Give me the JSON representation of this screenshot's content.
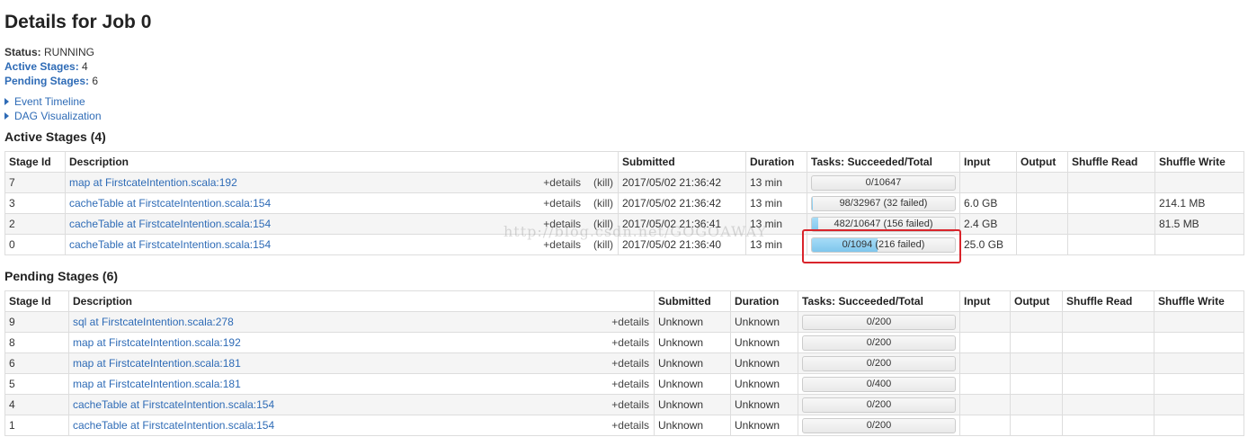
{
  "page": {
    "title": "Details for Job 0",
    "status_label": "Status:",
    "status_value": "RUNNING",
    "active_label": "Active Stages:",
    "active_value": "4",
    "pending_label": "Pending Stages:",
    "pending_value": "6",
    "event_timeline": "Event Timeline",
    "dag_visualization": "DAG Visualization"
  },
  "active": {
    "title": "Active Stages (4)",
    "headers": [
      "Stage Id",
      "Description",
      "Submitted",
      "Duration",
      "Tasks: Succeeded/Total",
      "Input",
      "Output",
      "Shuffle Read",
      "Shuffle Write"
    ],
    "rows": [
      {
        "id": "7",
        "desc": "map at FirstcateIntention.scala:192",
        "details": "+details",
        "kill": "(kill)",
        "submitted": "2017/05/02 21:36:42",
        "duration": "13 min",
        "tasks": "0/10647",
        "progress": 0.0,
        "input": "",
        "output": "",
        "shuffle_read": "",
        "shuffle_write": ""
      },
      {
        "id": "3",
        "desc": "cacheTable at FirstcateIntention.scala:154",
        "details": "+details",
        "kill": "(kill)",
        "submitted": "2017/05/02 21:36:42",
        "duration": "13 min",
        "tasks": "98/32967 (32 failed)",
        "progress": 0.003,
        "input": "6.0 GB",
        "output": "",
        "shuffle_read": "",
        "shuffle_write": "214.1 MB"
      },
      {
        "id": "2",
        "desc": "cacheTable at FirstcateIntention.scala:154",
        "details": "+details",
        "kill": "(kill)",
        "submitted": "2017/05/02 21:36:41",
        "duration": "13 min",
        "tasks": "482/10647 (156 failed)",
        "progress": 0.045,
        "input": "2.4 GB",
        "output": "",
        "shuffle_read": "",
        "shuffle_write": "81.5 MB"
      },
      {
        "id": "0",
        "desc": "cacheTable at FirstcateIntention.scala:154",
        "details": "+details",
        "kill": "(kill)",
        "submitted": "2017/05/02 21:36:40",
        "duration": "13 min",
        "tasks": "0/1094 (216 failed)",
        "progress": 0.46,
        "input": "25.0 GB",
        "output": "",
        "shuffle_read": "",
        "shuffle_write": ""
      }
    ]
  },
  "pending": {
    "title": "Pending Stages (6)",
    "headers": [
      "Stage Id",
      "Description",
      "Submitted",
      "Duration",
      "Tasks: Succeeded/Total",
      "Input",
      "Output",
      "Shuffle Read",
      "Shuffle Write"
    ],
    "rows": [
      {
        "id": "9",
        "desc": "sql at FirstcateIntention.scala:278",
        "details": "+details",
        "submitted": "Unknown",
        "duration": "Unknown",
        "tasks": "0/200",
        "progress": 0.0,
        "input": "",
        "output": "",
        "shuffle_read": "",
        "shuffle_write": ""
      },
      {
        "id": "8",
        "desc": "map at FirstcateIntention.scala:192",
        "details": "+details",
        "submitted": "Unknown",
        "duration": "Unknown",
        "tasks": "0/200",
        "progress": 0.0,
        "input": "",
        "output": "",
        "shuffle_read": "",
        "shuffle_write": ""
      },
      {
        "id": "6",
        "desc": "map at FirstcateIntention.scala:181",
        "details": "+details",
        "submitted": "Unknown",
        "duration": "Unknown",
        "tasks": "0/200",
        "progress": 0.0,
        "input": "",
        "output": "",
        "shuffle_read": "",
        "shuffle_write": ""
      },
      {
        "id": "5",
        "desc": "map at FirstcateIntention.scala:181",
        "details": "+details",
        "submitted": "Unknown",
        "duration": "Unknown",
        "tasks": "0/400",
        "progress": 0.0,
        "input": "",
        "output": "",
        "shuffle_read": "",
        "shuffle_write": ""
      },
      {
        "id": "4",
        "desc": "cacheTable at FirstcateIntention.scala:154",
        "details": "+details",
        "submitted": "Unknown",
        "duration": "Unknown",
        "tasks": "0/200",
        "progress": 0.0,
        "input": "",
        "output": "",
        "shuffle_read": "",
        "shuffle_write": ""
      },
      {
        "id": "1",
        "desc": "cacheTable at FirstcateIntention.scala:154",
        "details": "+details",
        "submitted": "Unknown",
        "duration": "Unknown",
        "tasks": "0/200",
        "progress": 0.0,
        "input": "",
        "output": "",
        "shuffle_read": "",
        "shuffle_write": ""
      }
    ]
  },
  "watermark": "http://blog.csdn.net/GOGOAWAY",
  "colors": {
    "link": "#2e6bb6",
    "progress_fill": "#8fcff0",
    "highlight": "#d9242b"
  }
}
